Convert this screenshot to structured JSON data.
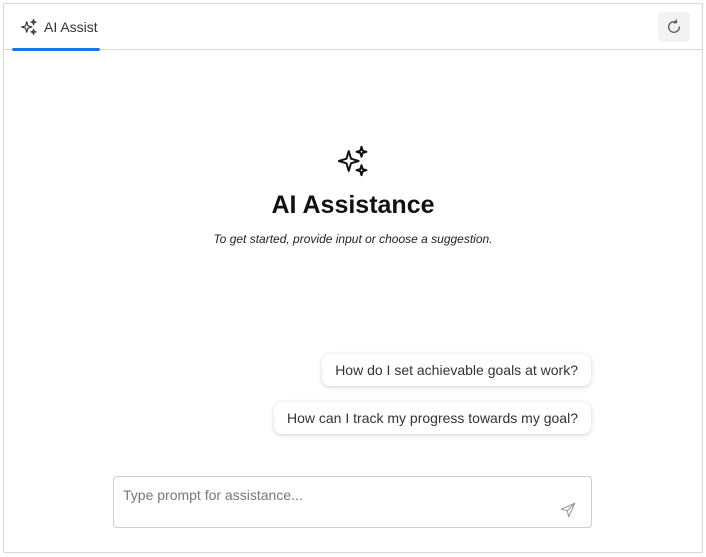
{
  "header": {
    "tab_label": "AI Assist",
    "tab_icon": "sparkle-icon",
    "refresh_icon": "refresh-icon"
  },
  "welcome": {
    "icon": "sparkle-icon",
    "title": "AI Assistance",
    "subtitle": "To get started, provide input or choose a suggestion."
  },
  "suggestions": [
    "How do I set achievable goals at work?",
    "How can I track my progress towards my goal?"
  ],
  "prompt": {
    "placeholder": "Type prompt for assistance...",
    "value": "",
    "send_icon": "send-icon"
  },
  "colors": {
    "accent": "#1a73e8",
    "border": "#d8d8d8",
    "refresh_bg": "#f3f3f3"
  }
}
